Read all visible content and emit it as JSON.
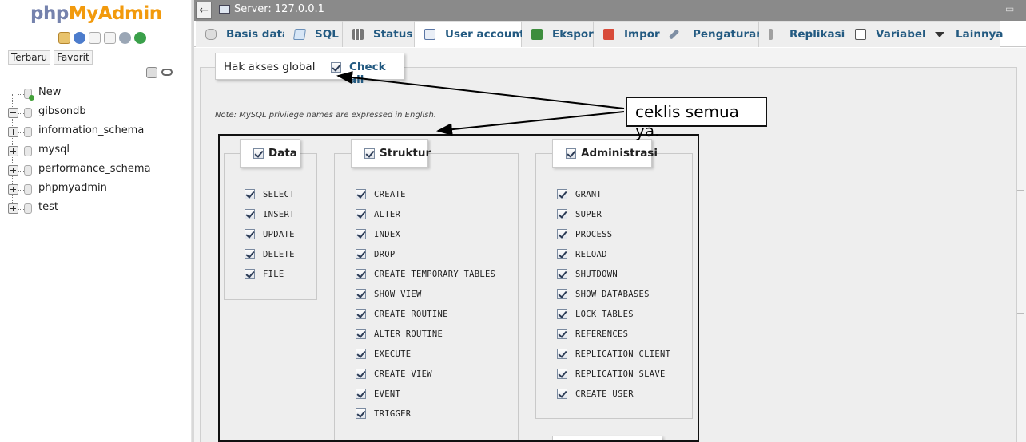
{
  "nav": {
    "logo_php": "php",
    "logo_myadmin": "MyAdmin",
    "tabs": [
      "Terbaru",
      "Favorit"
    ],
    "tree": [
      {
        "label": "New",
        "type": "new"
      },
      {
        "label": "gibsondb",
        "type": "db",
        "expanded": true
      },
      {
        "label": "information_schema",
        "type": "db"
      },
      {
        "label": "mysql",
        "type": "db"
      },
      {
        "label": "performance_schema",
        "type": "db"
      },
      {
        "label": "phpmyadmin",
        "type": "db"
      },
      {
        "label": "test",
        "type": "db"
      }
    ]
  },
  "topbar": {
    "back": "←",
    "server": "Server: 127.0.0.1"
  },
  "tabs": [
    {
      "label": "Basis data",
      "icon": "database-icon"
    },
    {
      "label": "SQL",
      "icon": "sql-icon"
    },
    {
      "label": "Status",
      "icon": "status-icon"
    },
    {
      "label": "User accounts",
      "icon": "users-icon",
      "active": true
    },
    {
      "label": "Ekspor",
      "icon": "export-icon"
    },
    {
      "label": "Impor",
      "icon": "import-icon"
    },
    {
      "label": "Pengaturan",
      "icon": "wrench-icon"
    },
    {
      "label": "Replikasi",
      "icon": "replication-icon"
    },
    {
      "label": "Variabel",
      "icon": "variables-icon"
    },
    {
      "label": "Lainnya",
      "icon": "chevron-down-icon"
    }
  ],
  "global": {
    "legend": "Hak akses global",
    "check_all": "Check all",
    "note": "Note: MySQL privilege names are expressed in English."
  },
  "groups": {
    "data": {
      "title": "Data",
      "items": [
        "SELECT",
        "INSERT",
        "UPDATE",
        "DELETE",
        "FILE"
      ]
    },
    "structure": {
      "title": "Struktur",
      "items": [
        "CREATE",
        "ALTER",
        "INDEX",
        "DROP",
        "CREATE TEMPORARY TABLES",
        "SHOW VIEW",
        "CREATE ROUTINE",
        "ALTER ROUTINE",
        "EXECUTE",
        "CREATE VIEW",
        "EVENT",
        "TRIGGER"
      ]
    },
    "admin": {
      "title": "Administrasi",
      "items": [
        "GRANT",
        "SUPER",
        "PROCESS",
        "RELOAD",
        "SHUTDOWN",
        "SHOW DATABASES",
        "LOCK TABLES",
        "REFERENCES",
        "REPLICATION CLIENT",
        "REPLICATION SLAVE",
        "CREATE USER"
      ]
    }
  },
  "annotation": {
    "text": "ceklis semua ya."
  },
  "colors": {
    "link_blue": "#235a81",
    "logo_blue": "#7582ad",
    "logo_orange": "#f29a0d",
    "topbar_gray": "#8a8a8a"
  }
}
